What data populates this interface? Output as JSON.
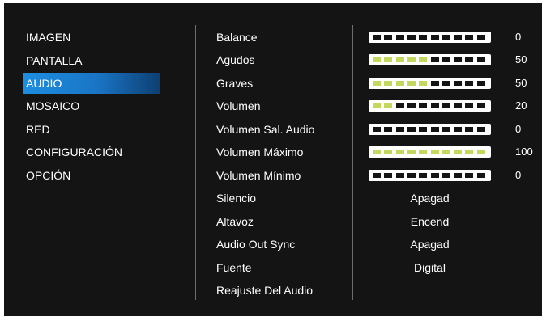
{
  "colors": {
    "selected": "#1e8ee0",
    "level_fill": "#c4d85e",
    "level_empty": "#141414"
  },
  "menu": [
    {
      "label": "IMAGEN",
      "selected": false
    },
    {
      "label": "PANTALLA",
      "selected": false
    },
    {
      "label": "AUDIO",
      "selected": true
    },
    {
      "label": "MOSAICO",
      "selected": false
    },
    {
      "label": "RED",
      "selected": false
    },
    {
      "label": "CONFIGURACIÓN",
      "selected": false
    },
    {
      "label": "OPCIÓN",
      "selected": false
    }
  ],
  "settings": [
    {
      "label": "Balance",
      "value": "0",
      "level_segments": 0
    },
    {
      "label": "Agudos",
      "value": "50",
      "level_segments": 5
    },
    {
      "label": "Graves",
      "value": "50",
      "level_segments": 5
    },
    {
      "label": "Volumen",
      "value": "20",
      "level_segments": 2
    },
    {
      "label": "Volumen Sal. Audio",
      "value": "0",
      "level_segments": 0
    },
    {
      "label": "Volumen Máximo",
      "value": "100",
      "level_segments": 10
    },
    {
      "label": "Volumen Mínimo",
      "value": "0",
      "level_segments": 0
    },
    {
      "label": "Silencio",
      "option": "Apagad"
    },
    {
      "label": "Altavoz",
      "option": "Encend"
    },
    {
      "label": "Audio Out Sync",
      "option": "Apagad"
    },
    {
      "label": "Fuente",
      "option": "Digital"
    },
    {
      "label": "Reajuste Del Audio"
    }
  ]
}
